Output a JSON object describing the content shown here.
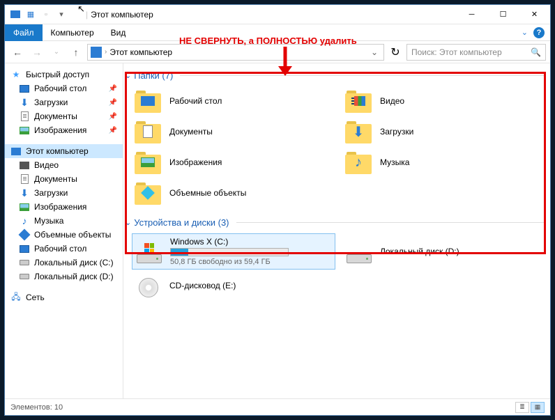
{
  "title": "Этот компьютер",
  "ribbon": {
    "file": "Файл",
    "computer": "Компьютер",
    "view": "Вид"
  },
  "nav": {
    "address": "Этот компьютер",
    "search_placeholder": "Поиск: Этот компьютер"
  },
  "annotation": "НЕ СВЕРНУТЬ, а ПОЛНОСТЬЮ удалить",
  "sidebar": {
    "quick": "Быстрый доступ",
    "q_items": [
      "Рабочий стол",
      "Загрузки",
      "Документы",
      "Изображения"
    ],
    "thispc": "Этот компьютер",
    "pc_items": [
      "Видео",
      "Документы",
      "Загрузки",
      "Изображения",
      "Музыка",
      "Объемные объекты",
      "Рабочий стол",
      "Локальный диск (C:)",
      "Локальный диск (D:)"
    ],
    "network": "Сеть"
  },
  "groups": {
    "folders_hdr": "Папки (7)",
    "devices_hdr": "Устройства и диски (3)"
  },
  "folders": {
    "desktop": "Рабочий стол",
    "video": "Видео",
    "documents": "Документы",
    "downloads": "Загрузки",
    "pictures": "Изображения",
    "music": "Музыка",
    "objects3d": "Объемные объекты"
  },
  "drives": {
    "c_name": "Windows X (C:)",
    "c_sub": "50,8 ГБ свободно из 59,4 ГБ",
    "c_fill_pct": 15,
    "d_name": "Локальный диск (D:)",
    "cd_name": "CD-дисковод (E:)"
  },
  "status": {
    "text": "Элементов: 10"
  }
}
